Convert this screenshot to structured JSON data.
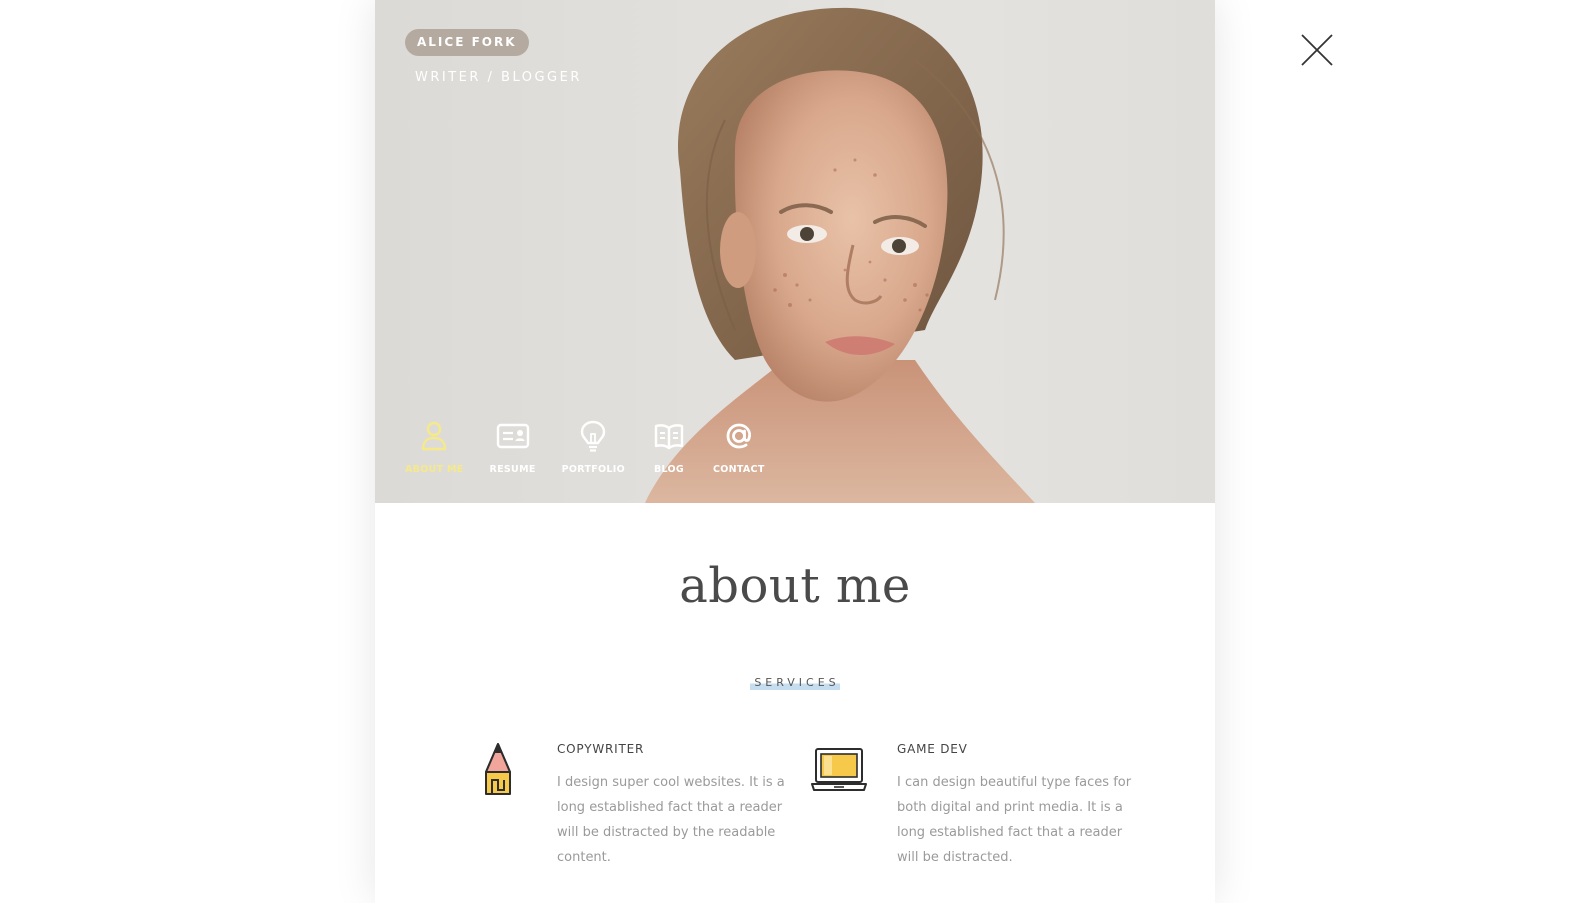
{
  "header": {
    "name": "ALICE FORK",
    "subtitle": "WRITER / BLOGGER"
  },
  "nav": {
    "items": [
      {
        "label": "ABOUT ME",
        "icon": "user-icon",
        "active": true
      },
      {
        "label": "RESUME",
        "icon": "id-card-icon",
        "active": false
      },
      {
        "label": "PORTFOLIO",
        "icon": "lightbulb-icon",
        "active": false
      },
      {
        "label": "BLOG",
        "icon": "book-icon",
        "active": false
      },
      {
        "label": "CONTACT",
        "icon": "at-sign-icon",
        "active": false
      }
    ]
  },
  "close_icon": "close-icon",
  "main": {
    "title": "about me",
    "services_label": "SERVICES",
    "services": [
      {
        "icon": "pencil-icon",
        "title": "COPYWRITER",
        "description": "I design super cool websites. It is a long established fact that a reader will be distracted by the readable content."
      },
      {
        "icon": "laptop-icon",
        "title": "GAME DEV",
        "description": "I can design beautiful type faces for both digital and print media. It is a long established fact that a reader will be distracted."
      }
    ]
  },
  "colors": {
    "accent_active": "#f5e98a",
    "badge_bg": "#b5aaa0",
    "title_text": "#4a4a4a",
    "body_text": "#9a9a9a",
    "highlight": "#c6dcef"
  }
}
